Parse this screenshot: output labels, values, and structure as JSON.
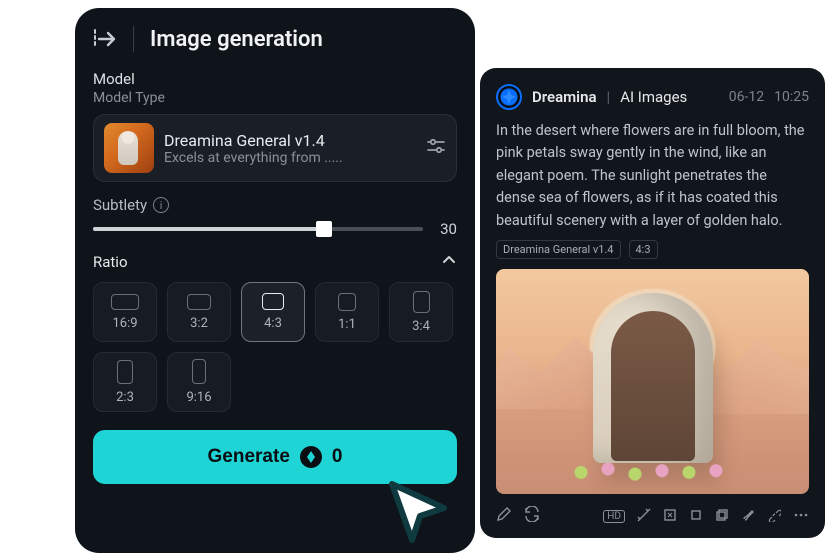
{
  "panel": {
    "title": "Image generation",
    "model_section": {
      "label": "Model",
      "sublabel": "Model Type",
      "name": "Dreamina General v1.4",
      "desc": "Excels at everything from ....."
    },
    "subtlety": {
      "label": "Subtlety",
      "value": "30"
    },
    "ratio": {
      "label": "Ratio",
      "options": [
        "16:9",
        "3:2",
        "4:3",
        "1:1",
        "3:4",
        "2:3",
        "9:16"
      ],
      "selected": "4:3",
      "shapes": {
        "16:9": [
          28,
          16
        ],
        "3:2": [
          24,
          16
        ],
        "4:3": [
          22,
          17
        ],
        "1:1": [
          18,
          18
        ],
        "3:4": [
          17,
          22
        ],
        "2:3": [
          16,
          24
        ],
        "9:16": [
          14,
          25
        ]
      }
    },
    "generate": {
      "label": "Generate",
      "credits": "0"
    }
  },
  "preview": {
    "app": "Dreamina",
    "section": "AI Images",
    "date": "06-12",
    "time": "10:25",
    "desc": "In the desert where flowers are in full bloom, the pink petals sway gently in the wind, like an elegant poem. The sunlight penetrates the dense sea of flowers, as if it has coated this beautiful scenery with a layer of golden halo.",
    "tags": [
      "Dreamina General v1.4",
      "4:3"
    ]
  }
}
